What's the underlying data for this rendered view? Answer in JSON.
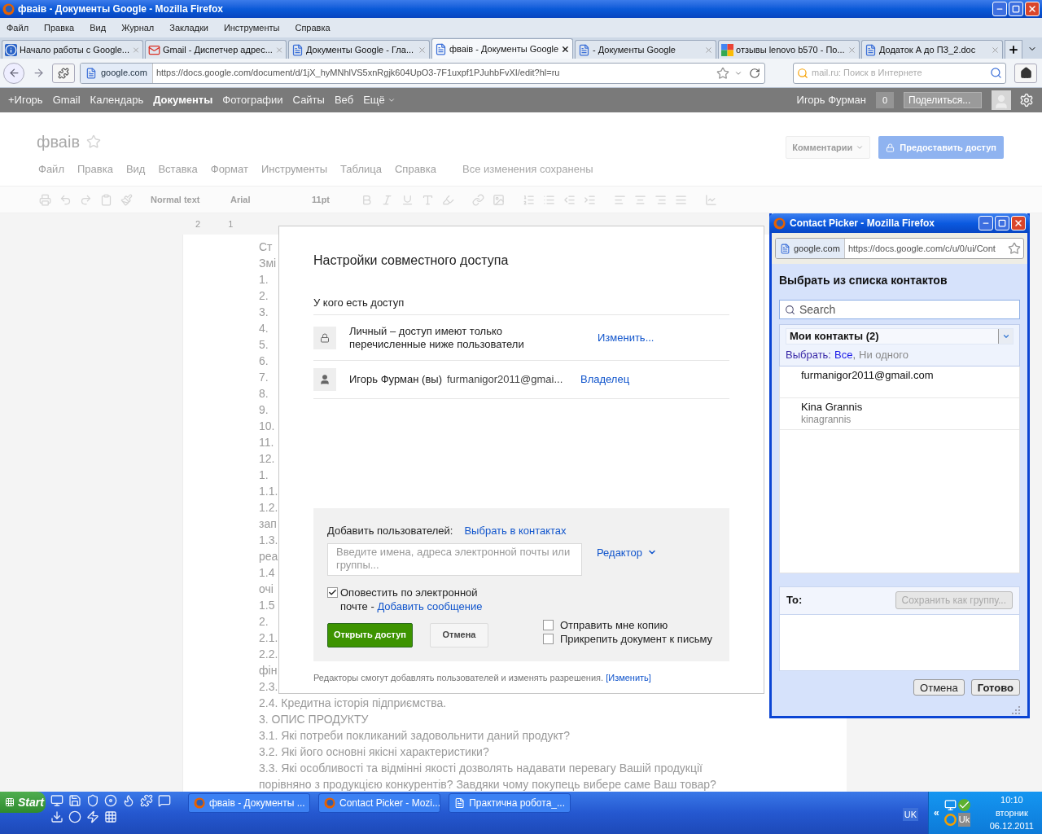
{
  "window": {
    "title": "фваів - Документы Google - Mozilla Firefox"
  },
  "menu_bar": [
    "Файл",
    "Правка",
    "Вид",
    "Журнал",
    "Закладки",
    "Инструменты",
    "Справка"
  ],
  "tabs": [
    {
      "label": "Начало работы с Google...",
      "selected": false
    },
    {
      "label": "Gmail - Диспетчер адрес...",
      "selected": false
    },
    {
      "label": "Документы Google - Гла...",
      "selected": false
    },
    {
      "label": "фваів - Документы Google",
      "selected": true
    },
    {
      "label": "- Документы Google",
      "selected": false
    },
    {
      "label": "отзывы lenovo b570 - По...",
      "selected": false
    },
    {
      "label": "Додаток А до ПЗ_2.doc",
      "selected": false
    }
  ],
  "address_bar": {
    "identity": "google.com",
    "url": "https://docs.google.com/document/d/1jX_hyMNhlVS5xnRgjk604UpO3-7F1uxpf1PJuhbFvXI/edit?hl=ru"
  },
  "search_bar": {
    "placeholder": "mail.ru: Поиск в Интернете"
  },
  "google_bar": {
    "links": [
      {
        "label": "+Игорь",
        "selected": false
      },
      {
        "label": "Gmail",
        "selected": false
      },
      {
        "label": "Календарь",
        "selected": false
      },
      {
        "label": "Документы",
        "selected": true
      },
      {
        "label": "Фотографии",
        "selected": false
      },
      {
        "label": "Сайты",
        "selected": false
      },
      {
        "label": "Веб",
        "selected": false
      },
      {
        "label": "Ещё",
        "selected": false
      }
    ],
    "user": "Игорь Фурман",
    "notifications": "0",
    "share_button": "Поделиться..."
  },
  "document": {
    "title": "фваів",
    "menu": [
      "Файл",
      "Правка",
      "Вид",
      "Вставка",
      "Формат",
      "Инструменты",
      "Таблица",
      "Справка"
    ],
    "save_status": "Все изменения сохранены",
    "comments_button": "Комментарии",
    "share_button": "Предоставить доступ",
    "toolbar": {
      "style": "Normal text",
      "font": "Arial",
      "size": "11pt"
    },
    "ruler": [
      "2",
      "1"
    ],
    "lines": [
      "Ст",
      "Змі",
      "1.",
      "2.",
      "3.",
      "4.",
      "5.",
      "6.",
      "7.",
      "8.",
      "9.",
      "10.",
      "11.",
      "12.",
      "1.",
      "1.1.",
      "1.2.",
      "зап",
      "1.3.",
      "реа",
      "1.4",
      "очі",
      "1.5",
      "2.",
      "2.1.",
      "2.2.",
      "фін",
      "2.3.",
      "2.4. Кредитна історія підприємства.",
      "3. ОПИС ПРОДУКТУ",
      "3.1. Які потреби покликаний задовольнити даний продукт?",
      "3.2. Які його основні якісні характеристики?",
      "3.3. Які особливості та відмінні якості дозволять надавати перевагу Вашій продукції",
      "порівняно з продукцією конкурентів? Завдяки чому покупець вибере саме Ваш товар?"
    ]
  },
  "share_dialog": {
    "title": "Настройки совместного доступа",
    "access_heading": "У кого есть доступ",
    "entries": [
      {
        "kind": "visibility",
        "text": "Личный – доступ имеют только перечисленные ниже пользователи",
        "action": "Изменить..."
      },
      {
        "kind": "person",
        "name": "Игорь Фурман (вы)",
        "email": "furmanigor2011@gmai...",
        "action": "Владелец"
      }
    ],
    "add_label": "Добавить пользователей:",
    "contacts_link": "Выбрать в контактах",
    "invite_placeholder": "Введите имена, адреса электронной почты или группы...",
    "permission": "Редактор",
    "notify": {
      "label": "Оповестить по электронной почте -",
      "link": "Добавить сообщение",
      "checked": true
    },
    "options": [
      {
        "label": "Отправить мне копию",
        "checked": false
      },
      {
        "label": "Прикрепить документ к письму",
        "checked": false
      }
    ],
    "share_button": "Открыть доступ",
    "cancel_button": "Отмена",
    "footer": "Редакторы смогут добавлять пользователей и изменять разрешения.",
    "footer_link": "[Изменить]"
  },
  "contact_picker": {
    "title": "Contact Picker - Mozilla Firefox",
    "identity": "google.com",
    "url": "https://docs.google.com/c/u/0/ui/Cont",
    "heading": "Выбрать из списка контактов",
    "search_placeholder": "Search",
    "group": "Мои контакты (2)",
    "select_label": "Выбрать:",
    "separator": ",",
    "select_options": [
      {
        "label": "Все",
        "disabled": false
      },
      {
        "label": "Ни одного",
        "disabled": true
      }
    ],
    "contacts": [
      {
        "name": "furmanigor2011@gmail.com"
      },
      {
        "name": "Kina Grannis",
        "detail": "kinagrannis"
      }
    ],
    "to_label": "To:",
    "save_group_button": "Сохранить как группу...",
    "cancel_button": "Отмена",
    "done_button": "Готово"
  },
  "taskbar": {
    "start": "Start",
    "tasks": [
      "фваів - Документы ...",
      "Contact Picker - Mozi...",
      "Практична робота_..."
    ],
    "language": "UK",
    "tray_expand": "«",
    "tray_language": "Uk",
    "time": "10:10",
    "day": "вторник",
    "date": "06.12.2011"
  }
}
